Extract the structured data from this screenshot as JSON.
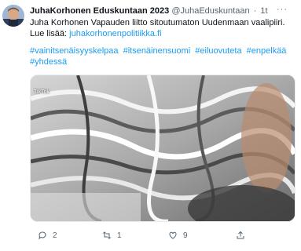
{
  "tweet": {
    "display_name": "JuhaKorhonen Eduskuntaan 2023",
    "handle": "@JuhaEduskuntaan",
    "separator": "·",
    "time": "1t",
    "line1": "Juha Korhonen Vapauden liitto sitoutumaton Uudenmaan vaalipiiri.",
    "line2_prefix": "Lue lisää:",
    "link": "juhakorhonenpolitiikka.fi",
    "hashtags": [
      "#vainitsenäisyyskelpaa",
      "#itsenäinensuomi",
      "#eiluovuteta",
      "#enpelkää",
      "#yhdessä"
    ],
    "media_overlay": "TikTok"
  },
  "actions": {
    "replies": "2",
    "retweets": "1",
    "likes": "9"
  },
  "colors": {
    "link": "#1d9bf0",
    "muted": "#536471"
  }
}
